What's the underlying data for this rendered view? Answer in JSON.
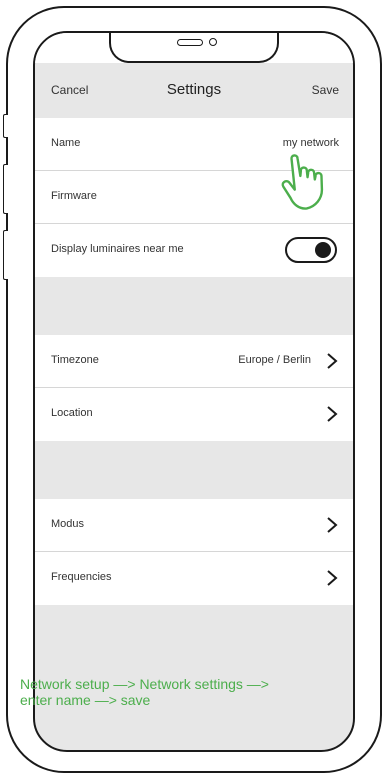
{
  "nav": {
    "cancel_label": "Cancel",
    "title": "Settings",
    "save_label": "Save"
  },
  "rows": {
    "name": {
      "label": "Name",
      "value": "my network"
    },
    "firmware": {
      "label": "Firmware"
    },
    "display_luminaires": {
      "label": "Display luminaires near me",
      "toggle_on": true
    },
    "timezone": {
      "label": "Timezone",
      "value": "Europe / Berlin"
    },
    "location": {
      "label": "Location"
    },
    "modus": {
      "label": "Modus"
    },
    "frequencies": {
      "label": "Frequencies"
    }
  },
  "caption": {
    "line1": "Network setup —> Network settings —>",
    "line2": "enter name —> save"
  },
  "colors": {
    "caption_green": "#4cae4c",
    "hand_green": "#4cae4c",
    "group_gap": "#e7e7e7"
  },
  "icons": {
    "chevron": "chevron-right-icon",
    "hand": "pointing-hand-icon"
  }
}
